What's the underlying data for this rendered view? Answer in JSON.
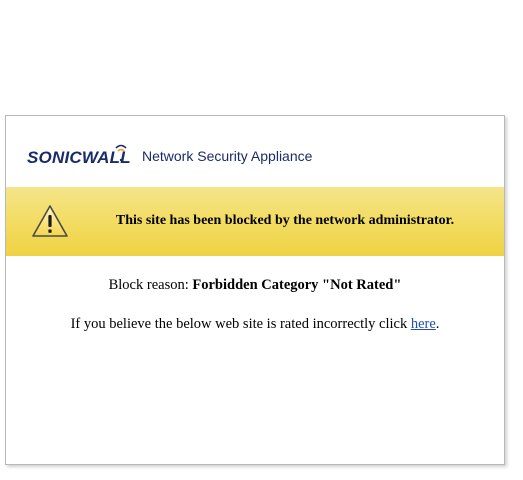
{
  "header": {
    "brand": "SONICWALL",
    "title": "Network Security Appliance"
  },
  "alert": {
    "icon": "warning-icon",
    "message": "This site has been blocked by the network administrator."
  },
  "block": {
    "reason_label": "Block reason: ",
    "reason_value": "Forbidden Category \"Not Rated\""
  },
  "report": {
    "text_before": "If you believe the below web site is rated incorrectly click ",
    "link_text": "here",
    "text_after": "."
  },
  "colors": {
    "brand": "#1a2b6b",
    "accent_arc": "#f2a01e",
    "alert_band": "#f2dc62",
    "link": "#1f4fb3"
  }
}
